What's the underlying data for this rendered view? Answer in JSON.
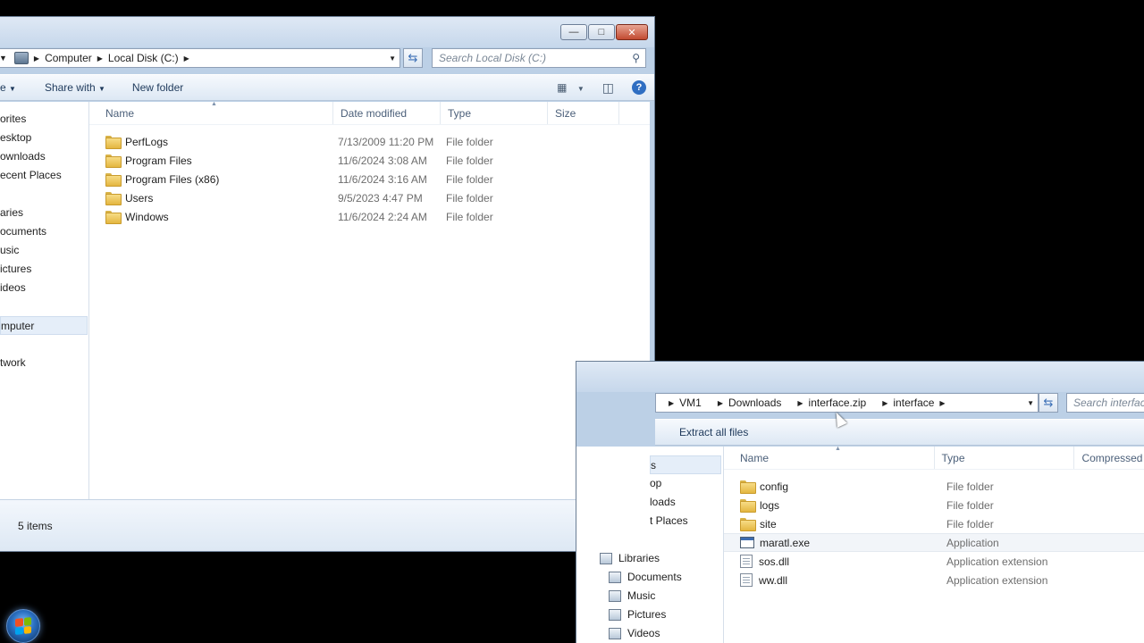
{
  "window1": {
    "breadcrumb": [
      "Computer",
      "Local Disk (C:)"
    ],
    "search_placeholder": "Search Local Disk (C:)",
    "toolbar": {
      "organize_fragment": "e",
      "share_with": "Share with",
      "new_folder": "New folder"
    },
    "nav_items": [
      "orites",
      "esktop",
      "ownloads",
      "ecent Places",
      "",
      "aries",
      "ocuments",
      "usic",
      "ictures",
      "ideos",
      "",
      "mputer",
      "",
      "twork"
    ],
    "columns": {
      "name": "Name",
      "date": "Date modified",
      "type": "Type",
      "size": "Size"
    },
    "files": [
      {
        "name": "PerfLogs",
        "date": "7/13/2009 11:20 PM",
        "type": "File folder"
      },
      {
        "name": "Program Files",
        "date": "11/6/2024 3:08 AM",
        "type": "File folder"
      },
      {
        "name": "Program Files (x86)",
        "date": "11/6/2024 3:16 AM",
        "type": "File folder"
      },
      {
        "name": "Users",
        "date": "9/5/2023 4:47 PM",
        "type": "File folder"
      },
      {
        "name": "Windows",
        "date": "11/6/2024 2:24 AM",
        "type": "File folder"
      }
    ],
    "status": "5 items"
  },
  "window2": {
    "breadcrumb": [
      "VM1",
      "Downloads",
      "interface.zip",
      "interface"
    ],
    "search_placeholder": "Search interfac",
    "toolbar": {
      "extract_all": "Extract all files"
    },
    "nav_items": [
      "s",
      "op",
      "loads",
      "t Places"
    ],
    "libraries": [
      {
        "label": "Libraries",
        "icon": "libraries-icon"
      },
      {
        "label": "Documents",
        "icon": "documents-icon"
      },
      {
        "label": "Music",
        "icon": "music-icon"
      },
      {
        "label": "Pictures",
        "icon": "pictures-icon"
      },
      {
        "label": "Videos",
        "icon": "videos-icon"
      }
    ],
    "columns": {
      "name": "Name",
      "type": "Type",
      "compressed": "Compressed"
    },
    "files": [
      {
        "name": "config",
        "type": "File folder",
        "icon": "folder"
      },
      {
        "name": "logs",
        "type": "File folder",
        "icon": "folder"
      },
      {
        "name": "site",
        "type": "File folder",
        "icon": "folder"
      },
      {
        "name": "maratl.exe",
        "type": "Application",
        "icon": "exe"
      },
      {
        "name": "sos.dll",
        "type": "Application extension",
        "icon": "file"
      },
      {
        "name": "ww.dll",
        "type": "Application extension",
        "icon": "file"
      }
    ]
  },
  "colors": {
    "accent": "#3c6bb0",
    "titlebar": "#c6d7eb",
    "desktop": "#000000"
  }
}
